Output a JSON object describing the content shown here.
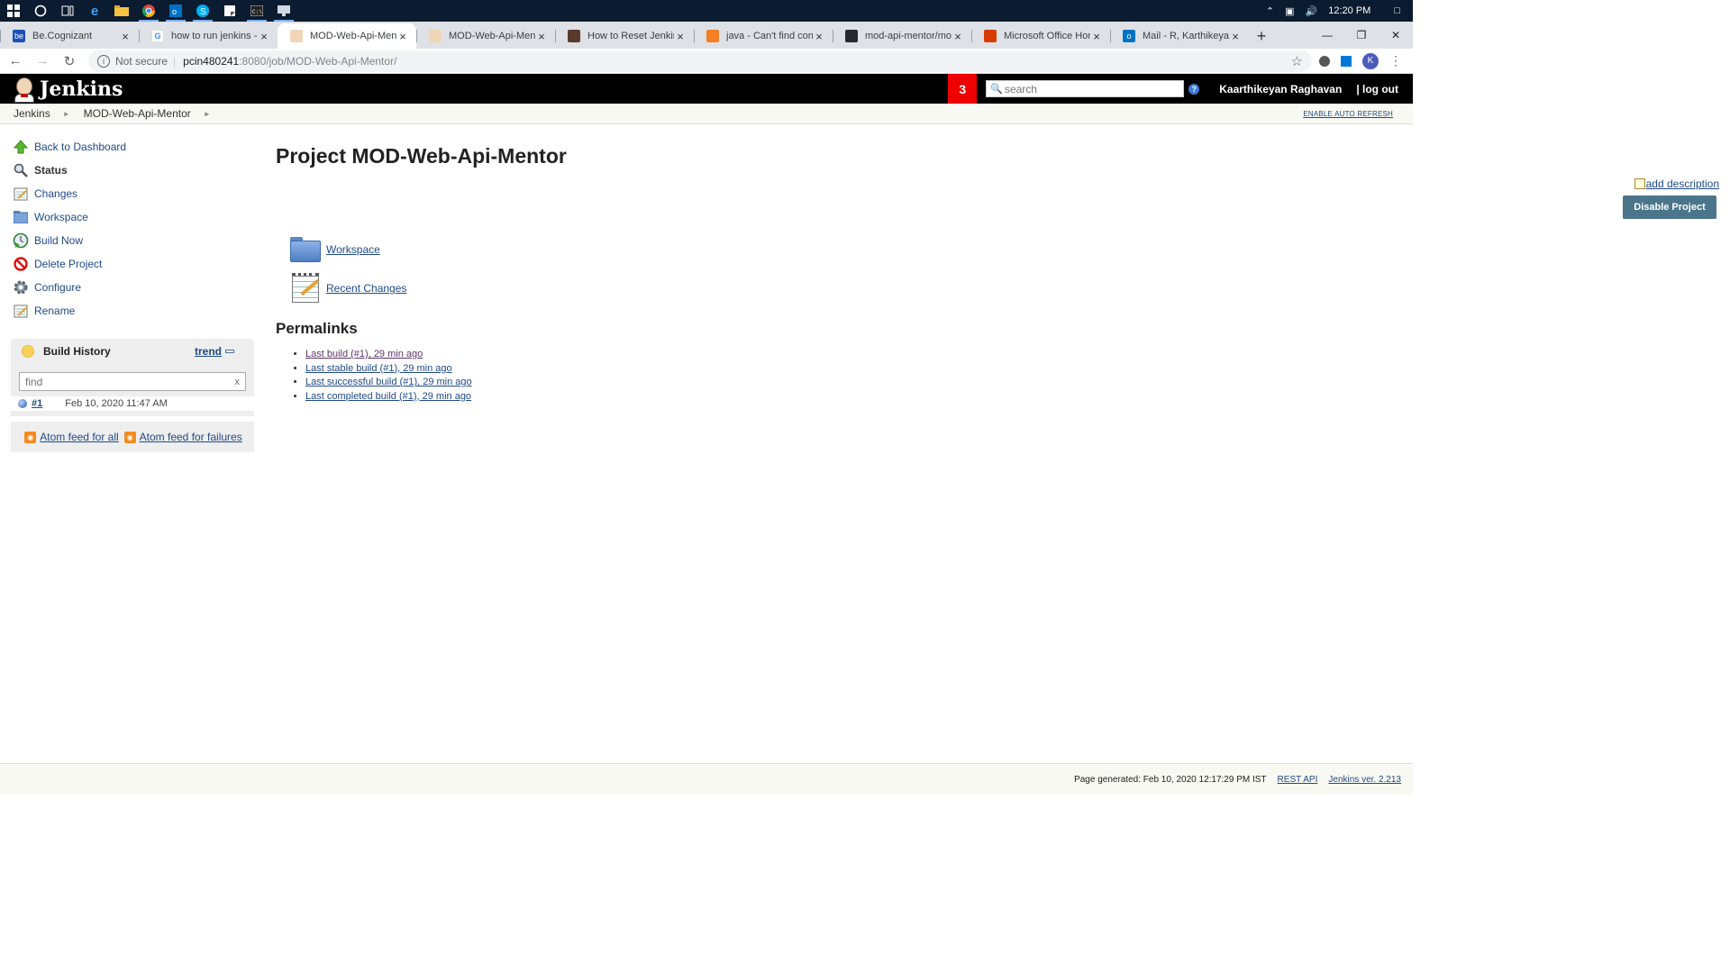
{
  "taskbar": {
    "clock": "12:20 PM"
  },
  "browser": {
    "tabs": [
      {
        "title": "Be.Cognizant",
        "favicon": "be-icon",
        "color": "#1a4fba",
        "glyph": "be"
      },
      {
        "title": "how to run jenkins - Go",
        "favicon": "google-icon",
        "color": "#ffffff",
        "glyph": "G"
      },
      {
        "title": "MOD-Web-Api-Mentor",
        "favicon": "jenkins-icon",
        "color": "#f0d6b7",
        "glyph": ""
      },
      {
        "title": "MOD-Web-Api-Mentor",
        "favicon": "jenkins-icon",
        "color": "#f0d6b7",
        "glyph": ""
      },
      {
        "title": "How to Reset Jenkins A",
        "favicon": "avatar-icon",
        "color": "#5a3a2a",
        "glyph": ""
      },
      {
        "title": "java - Can't find config",
        "favicon": "stackoverflow-icon",
        "color": "#f48024",
        "glyph": ""
      },
      {
        "title": "mod-api-mentor/mod",
        "favicon": "github-icon",
        "color": "#24292e",
        "glyph": ""
      },
      {
        "title": "Microsoft Office Home",
        "favicon": "office-icon",
        "color": "#d83b01",
        "glyph": ""
      },
      {
        "title": "Mail - R, Karthikeyan (",
        "favicon": "outlook-icon",
        "color": "#0072c6",
        "glyph": "o"
      }
    ],
    "active_tab": 2,
    "address": {
      "not_secure": "Not secure",
      "host": "pcin480241",
      "path": ":8080/job/MOD-Web-Api-Mentor/"
    },
    "avatar_letter": "K"
  },
  "jenkins": {
    "brand": "Jenkins",
    "notification_count": "3",
    "search_placeholder": "search",
    "user": "Kaarthikeyan Raghavan",
    "logout": "| log out",
    "breadcrumb": [
      "Jenkins",
      "MOD-Web-Api-Mentor"
    ],
    "auto_refresh": "ENABLE AUTO REFRESH",
    "tasks": [
      {
        "label": "Back to Dashboard",
        "icon": "up-arrow-icon"
      },
      {
        "label": "Status",
        "icon": "magnifier-icon"
      },
      {
        "label": "Changes",
        "icon": "notepad-icon"
      },
      {
        "label": "Workspace",
        "icon": "folder-icon"
      },
      {
        "label": "Build Now",
        "icon": "clock-play-icon"
      },
      {
        "label": "Delete Project",
        "icon": "no-entry-icon"
      },
      {
        "label": "Configure",
        "icon": "gear-icon"
      },
      {
        "label": "Rename",
        "icon": "notepad-icon"
      }
    ],
    "build_history": {
      "title": "Build History",
      "trend": "trend",
      "find_placeholder": "find",
      "clear": "x",
      "builds": [
        {
          "number": "#1",
          "date": "Feb 10, 2020 11:47 AM"
        }
      ],
      "feed_all": "Atom feed for all",
      "feed_failures": "Atom feed for failures"
    },
    "project_title": "Project MOD-Web-Api-Mentor",
    "add_description": "add description",
    "disable_button": "Disable Project",
    "main_links": {
      "workspace": "Workspace",
      "recent_changes": "Recent Changes"
    },
    "permalinks_heading": "Permalinks",
    "permalinks": [
      "Last build (#1), 29 min ago",
      "Last stable build (#1), 29 min ago",
      "Last successful build (#1), 29 min ago",
      "Last completed build (#1), 29 min ago"
    ],
    "footer": {
      "generated": "Page generated: Feb 10, 2020 12:17:29 PM IST",
      "rest_api": "REST API",
      "version": "Jenkins ver. 2.213"
    }
  }
}
